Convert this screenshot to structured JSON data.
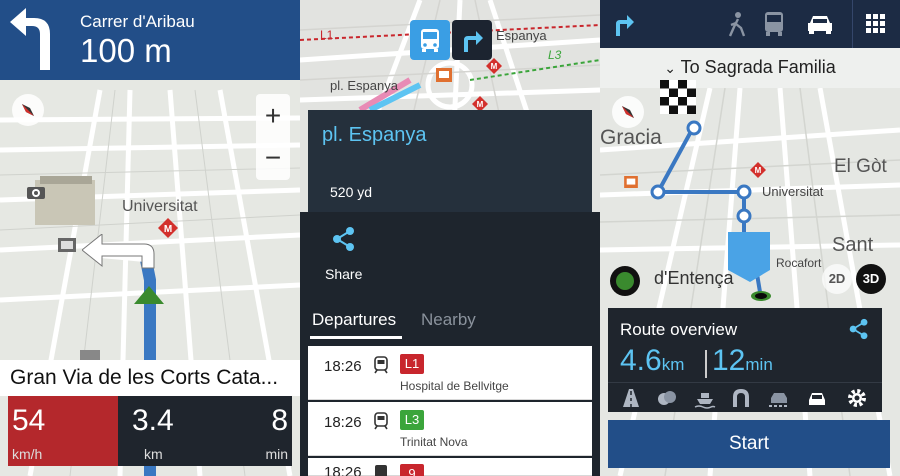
{
  "panel1": {
    "nav": {
      "street": "Carrer d'Aribau",
      "distance": "100 m"
    },
    "zoom": {
      "plus": "+",
      "minus": "−"
    },
    "map_labels": {
      "universitat": "Universitat"
    },
    "current_street": "Gran Via de les Corts Cata...",
    "stats": [
      {
        "value": "54",
        "unit": "km/h"
      },
      {
        "value": "3.4",
        "unit": "km"
      },
      {
        "value": "8",
        "unit": "min"
      }
    ],
    "icons": [
      "turn-left-icon",
      "compass-icon",
      "camera-icon",
      "metro-icon",
      "position-arrow-icon"
    ],
    "colors": {
      "header": "#224e88",
      "speed": "#b4282c",
      "route": "#3a78c2"
    }
  },
  "panel2": {
    "modes": [
      "bus-icon",
      "directions-icon"
    ],
    "map_labels": {
      "l1": "L1",
      "l3": "L3",
      "espanya": "Espanya",
      "pl_espanya": "pl. Espanya"
    },
    "place": {
      "name": "pl. Espanya",
      "distance": "520 yd"
    },
    "share_label": "Share",
    "tabs": {
      "departures": "Departures",
      "nearby": "Nearby"
    },
    "departures": [
      {
        "time": "18:26",
        "line": "L1",
        "color": "#c8262d",
        "destination": "Hospital de Bellvitge"
      },
      {
        "time": "18:26",
        "line": "L3",
        "color": "#3ba53b",
        "destination": "Trinitat Nova"
      },
      {
        "time": "18:26",
        "line": "9",
        "color": "#c8262d",
        "destination": ""
      }
    ]
  },
  "panel3": {
    "top_icons": [
      "directions-icon",
      "walk-icon",
      "bus-icon",
      "car-icon",
      "grid-icon"
    ],
    "destination": "To Sagrada Familia",
    "map_labels": {
      "gracia": "Gracia",
      "el_got": "El Gòt",
      "universitat": "Universitat",
      "sant": "Sant",
      "rocafort": "Rocafort",
      "entenca": "d'Entença"
    },
    "route": {
      "title": "Route overview",
      "distance": "4.6",
      "distance_unit": "km",
      "time": "12",
      "time_unit": "min"
    },
    "options": [
      "highway-icon",
      "toll-icon",
      "ferry-icon",
      "tunnel-icon",
      "car-train-icon",
      "carpool-icon",
      "settings-icon"
    ],
    "view_2d": "2D",
    "view_3d": "3D",
    "start_label": "Start"
  }
}
